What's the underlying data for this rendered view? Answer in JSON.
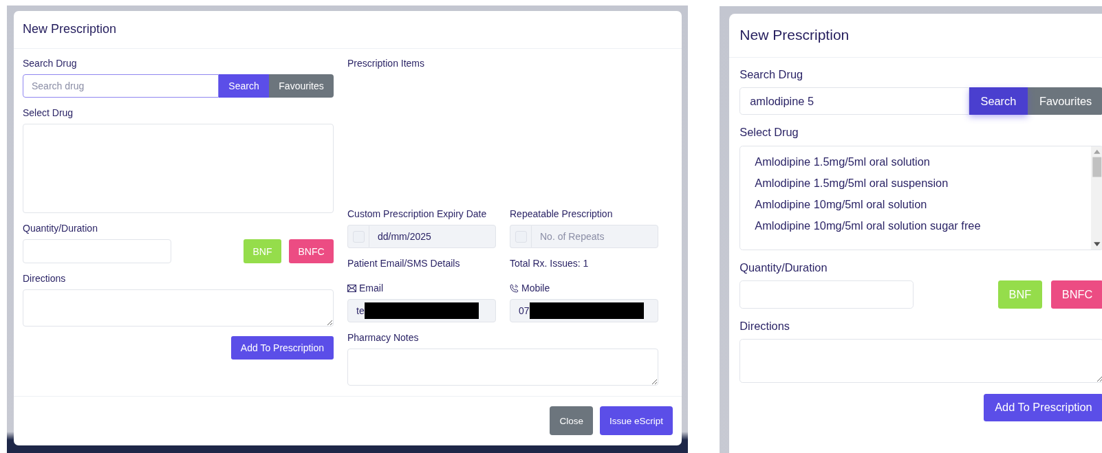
{
  "panels": [
    {
      "title": "New Prescription",
      "search_label": "Search Drug",
      "search_field": {
        "placeholder": "Search drug"
      },
      "search_button": "Search",
      "favourites_button": "Favourites",
      "select_label": "Select Drug",
      "quantity_label": "Quantity/Duration",
      "bnf_button": "BNF",
      "bnfc_button": "BNFC",
      "directions_label": "Directions",
      "add_button": "Add To Prescription",
      "right_column": {
        "items_label": "Prescription Items",
        "expiry": {
          "label": "Custom Prescription Expiry Date",
          "checked": false,
          "value": "dd/mm/2025"
        },
        "repeat": {
          "label": "Repeatable Prescription",
          "checked": false,
          "placeholder": "No. of Repeats"
        },
        "contact_label": "Patient Email/SMS Details",
        "total_issues": "Total Rx. Issues: 1",
        "email": {
          "label": "Email",
          "value": "te",
          "redacted": true
        },
        "mobile": {
          "label": "Mobile",
          "value": "07",
          "redacted": true
        },
        "notes_label": "Pharmacy Notes"
      },
      "footer": [
        {
          "kind": "secondary",
          "label": "Close"
        },
        {
          "kind": "primary",
          "label": "Issue eScript"
        }
      ]
    },
    {
      "title": "New Prescription",
      "search_label": "Search Drug",
      "search_field": {
        "value": "amlodipine 5"
      },
      "search_button": "Search",
      "favourites_button": "Favourites",
      "select_label": "Select Drug",
      "drug_options": [
        "Amlodipine 1.5mg/5ml oral solution",
        "Amlodipine 1.5mg/5ml oral suspension",
        "Amlodipine 10mg/5ml oral solution",
        "Amlodipine 10mg/5ml oral solution sugar free"
      ],
      "quantity_label": "Quantity/Duration",
      "bnf_button": "BNF",
      "bnfc_button": "BNFC",
      "directions_label": "Directions",
      "add_button": "Add To Prescription"
    }
  ]
}
